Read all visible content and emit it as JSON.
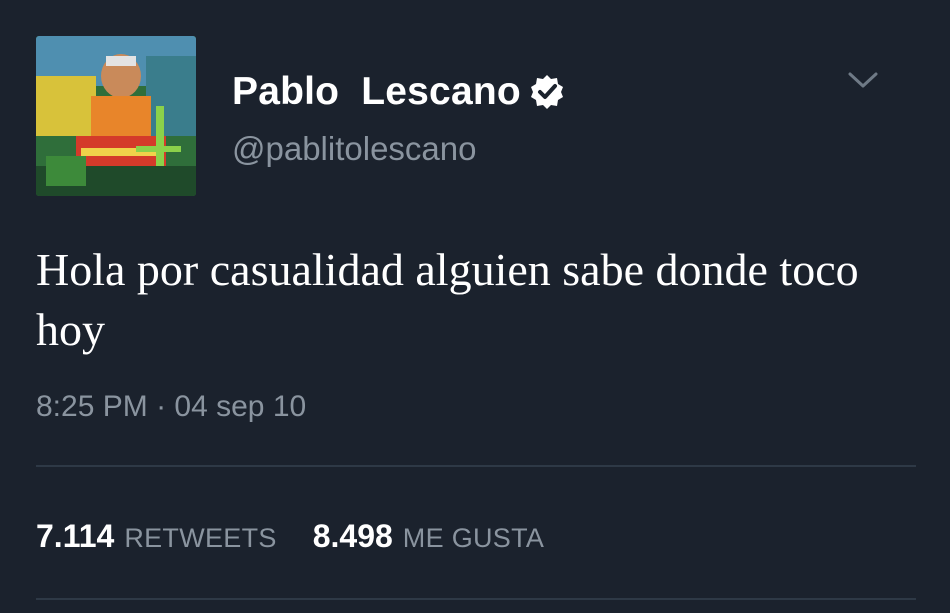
{
  "user": {
    "display_name": "Pablo  Lescano",
    "handle": "@pablitolescano",
    "avatar_icon": "profile-photo",
    "verified_icon": "verified-badge-icon"
  },
  "tweet": {
    "text": "Hola por casualidad alguien sabe donde toco hoy",
    "time": "8:25 PM",
    "separator": "·",
    "date": "04 sep 10"
  },
  "stats": {
    "retweets_count": "7.114",
    "retweets_label": "RETWEETS",
    "likes_count": "8.498",
    "likes_label": "ME GUSTA"
  },
  "colors": {
    "background": "#1b222d",
    "primary_text": "#ffffff",
    "secondary_text": "#8a949f",
    "divider": "#2e3946"
  }
}
